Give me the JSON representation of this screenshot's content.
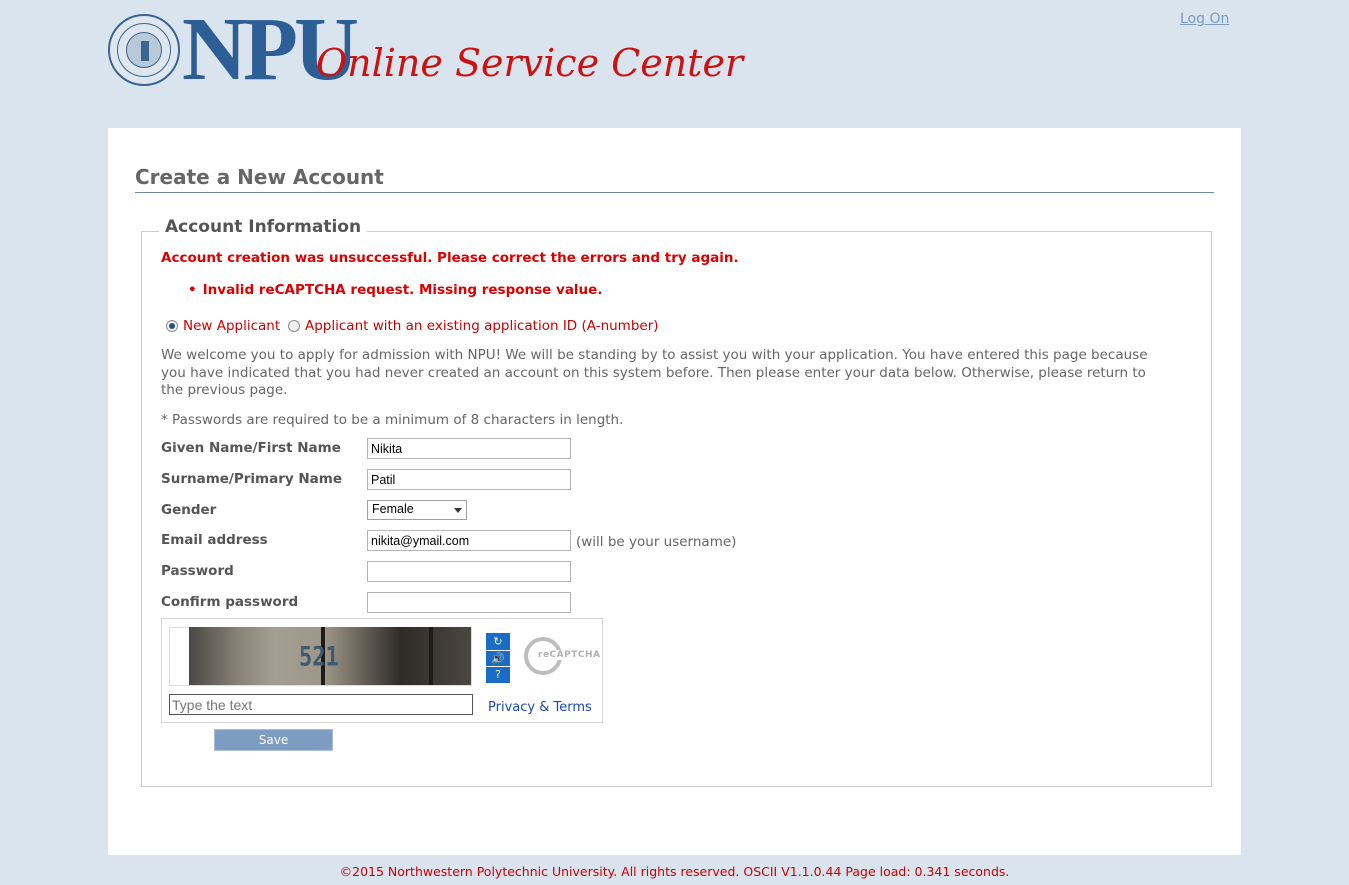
{
  "header": {
    "logo_text": "NPU",
    "tagline": "Online Service Center",
    "logon_label": "Log On"
  },
  "page": {
    "title": "Create a New Account",
    "legend": "Account Information"
  },
  "errors": {
    "summary": "Account creation was unsuccessful. Please correct the errors and try again.",
    "items": [
      "Invalid reCAPTCHA request. Missing response value."
    ]
  },
  "applicant_type": {
    "options": [
      "New Applicant",
      "Applicant with an existing application ID (A-number)"
    ],
    "selected": "New Applicant"
  },
  "welcome_text": "We welcome you to apply for admission with NPU! We will be standing by to assist you with your application. You have entered this page because you have indicated that you had never created an account on this system before. Then please enter your data below. Otherwise, please return to the previous page.",
  "password_note": "* Passwords are required to be a minimum of 8 characters in length.",
  "form": {
    "first_name_label": "Given Name/First Name",
    "first_name_value": "Nikita",
    "surname_label": "Surname/Primary Name",
    "surname_value": "Patil",
    "gender_label": "Gender",
    "gender_value": "Female",
    "email_label": "Email address",
    "email_value": "nikita@ymail.com",
    "email_hint": "(will be your username)",
    "password_label": "Password",
    "password_value": "",
    "confirm_label": "Confirm password",
    "confirm_value": ""
  },
  "captcha": {
    "image_text": "521",
    "input_placeholder": "Type the text",
    "privacy_label": "Privacy & Terms",
    "logo_text": "reCAPTCHA"
  },
  "save_label": "Save",
  "footer": "©2015 Northwestern Polytechnic University. All rights reserved. OSCII V1.1.0.44 Page load: 0.341 seconds."
}
